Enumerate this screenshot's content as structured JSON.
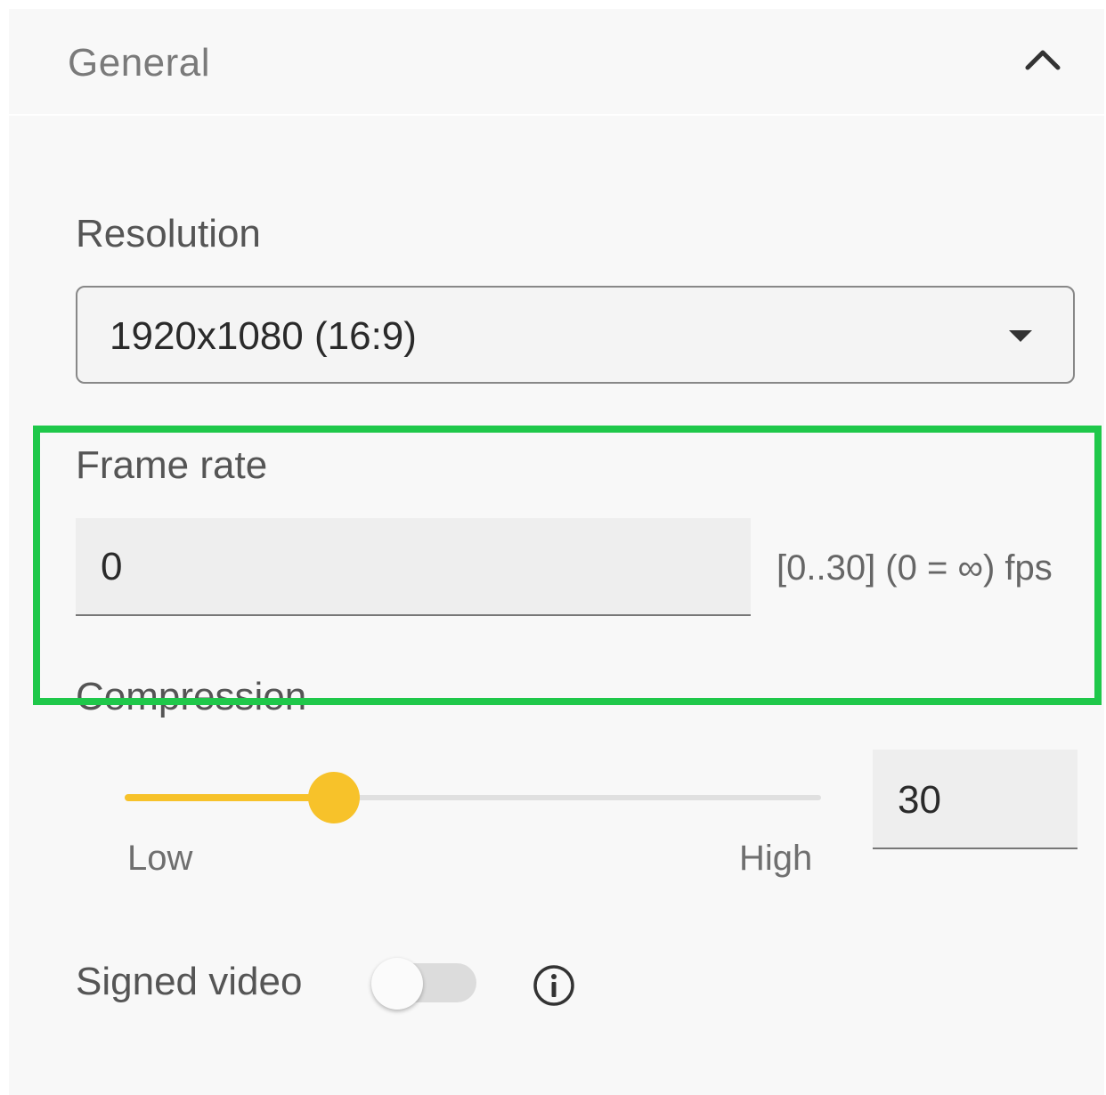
{
  "section": {
    "title": "General",
    "toggle_icon": "chevron-up-icon"
  },
  "resolution": {
    "label": "Resolution",
    "selected": "1920x1080 (16:9)",
    "arrow_icon": "dropdown-arrow-icon"
  },
  "frame_rate": {
    "label": "Frame rate",
    "value": "0",
    "hint": "[0..30] (0 = ∞) fps"
  },
  "compression": {
    "label": "Compression",
    "value": "30",
    "slider_fraction": 0.3,
    "low_label": "Low",
    "high_label": "High",
    "accent_color": "#f7c22a"
  },
  "signed_video": {
    "label": "Signed video",
    "enabled": false,
    "info_icon": "info-icon"
  },
  "highlight_color": "#1fc84a"
}
